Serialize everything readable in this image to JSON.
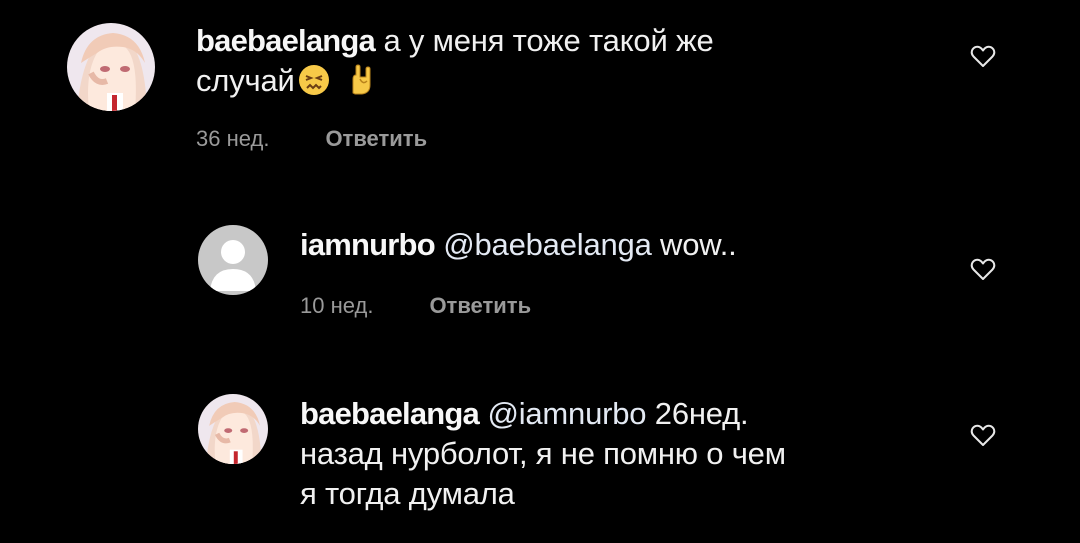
{
  "comments": [
    {
      "username": "baebaelanga",
      "text_line1": "а у меня тоже такой же",
      "text_line2": "случай",
      "emojis": [
        "confounded-face-emoji",
        "sign-of-horns-emoji"
      ],
      "time": "36 нед.",
      "reply_label": "Ответить",
      "avatar": "anime-girl-avatar"
    },
    {
      "username": "iamnurbo",
      "mention": "@baebaelanga",
      "text": "wow..",
      "time": "10 нед.",
      "reply_label": "Ответить",
      "avatar": "default-profile-avatar"
    },
    {
      "username": "baebaelanga",
      "mention": "@iamnurbo",
      "text_line1": "26нед.",
      "text_line2": "назад нурболот, я не помню о чем",
      "text_line3": "я тогда думала",
      "avatar": "anime-girl-avatar"
    }
  ],
  "icons": {
    "like": "heart-outline-icon"
  },
  "colors": {
    "background": "#000000",
    "text": "#f5f5f5",
    "meta": "#9a9a9a"
  }
}
